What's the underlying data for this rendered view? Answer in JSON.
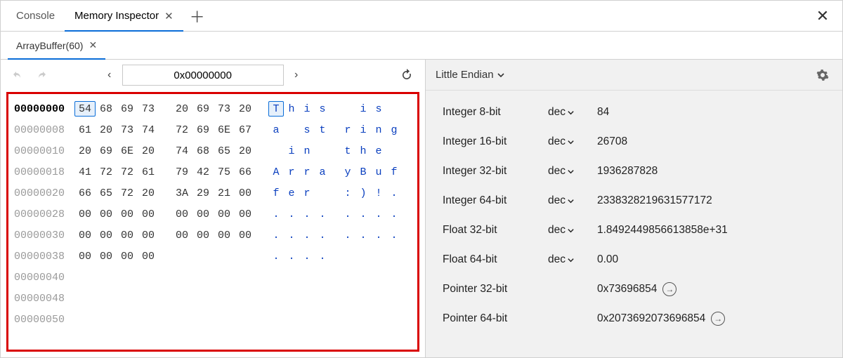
{
  "tabs": {
    "console": "Console",
    "memory_inspector": "Memory Inspector"
  },
  "sub_tabs": {
    "buffer": "ArrayBuffer(60)"
  },
  "toolbar": {
    "address": "0x00000000"
  },
  "hex": {
    "rows": [
      {
        "addr": "00000000",
        "active": true,
        "bytes": [
          "54",
          "68",
          "69",
          "73",
          "20",
          "69",
          "73",
          "20"
        ],
        "ascii": [
          "T",
          "h",
          "i",
          "s",
          " ",
          "i",
          "s",
          " "
        ],
        "sel": 0
      },
      {
        "addr": "00000008",
        "bytes": [
          "61",
          "20",
          "73",
          "74",
          "72",
          "69",
          "6E",
          "67"
        ],
        "ascii": [
          "a",
          " ",
          "s",
          "t",
          "r",
          "i",
          "n",
          "g"
        ]
      },
      {
        "addr": "00000010",
        "bytes": [
          "20",
          "69",
          "6E",
          "20",
          "74",
          "68",
          "65",
          "20"
        ],
        "ascii": [
          " ",
          "i",
          "n",
          " ",
          "t",
          "h",
          "e",
          " "
        ]
      },
      {
        "addr": "00000018",
        "bytes": [
          "41",
          "72",
          "72",
          "61",
          "79",
          "42",
          "75",
          "66"
        ],
        "ascii": [
          "A",
          "r",
          "r",
          "a",
          "y",
          "B",
          "u",
          "f"
        ]
      },
      {
        "addr": "00000020",
        "bytes": [
          "66",
          "65",
          "72",
          "20",
          "3A",
          "29",
          "21",
          "00"
        ],
        "ascii": [
          "f",
          "e",
          "r",
          " ",
          ":",
          ")",
          "!",
          "."
        ]
      },
      {
        "addr": "00000028",
        "bytes": [
          "00",
          "00",
          "00",
          "00",
          "00",
          "00",
          "00",
          "00"
        ],
        "ascii": [
          ".",
          ".",
          ".",
          ".",
          ".",
          ".",
          ".",
          "."
        ]
      },
      {
        "addr": "00000030",
        "bytes": [
          "00",
          "00",
          "00",
          "00",
          "00",
          "00",
          "00",
          "00"
        ],
        "ascii": [
          ".",
          ".",
          ".",
          ".",
          ".",
          ".",
          ".",
          "."
        ]
      },
      {
        "addr": "00000038",
        "bytes": [
          "00",
          "00",
          "00",
          "00"
        ],
        "ascii": [
          ".",
          ".",
          ".",
          "."
        ]
      },
      {
        "addr": "00000040",
        "bytes": [],
        "ascii": []
      },
      {
        "addr": "00000048",
        "bytes": [],
        "ascii": []
      },
      {
        "addr": "00000050",
        "bytes": [],
        "ascii": []
      }
    ]
  },
  "endian": "Little Endian",
  "values": [
    {
      "label": "Integer 8-bit",
      "unit": "dec",
      "value": "84"
    },
    {
      "label": "Integer 16-bit",
      "unit": "dec",
      "value": "26708"
    },
    {
      "label": "Integer 32-bit",
      "unit": "dec",
      "value": "1936287828"
    },
    {
      "label": "Integer 64-bit",
      "unit": "dec",
      "value": "2338328219631577172"
    },
    {
      "label": "Float 32-bit",
      "unit": "dec",
      "value": "1.8492449856613858e+31"
    },
    {
      "label": "Float 64-bit",
      "unit": "dec",
      "value": "0.00"
    },
    {
      "label": "Pointer 32-bit",
      "unit": "",
      "value": "0x73696854",
      "jump": true
    },
    {
      "label": "Pointer 64-bit",
      "unit": "",
      "value": "0x2073692073696854",
      "jump": true
    }
  ]
}
